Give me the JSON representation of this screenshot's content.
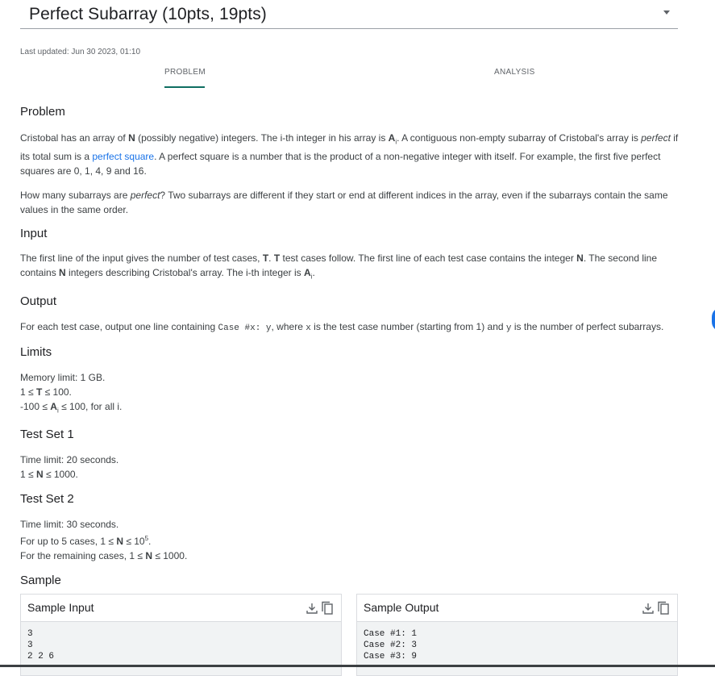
{
  "page": {
    "title": "Perfect Subarray (10pts, 19pts)",
    "last_updated": "Last updated: Jun 30 2023, 01:10",
    "tabs": [
      {
        "label": "PROBLEM",
        "active": true
      },
      {
        "label": "ANALYSIS",
        "active": false
      }
    ]
  },
  "problem": {
    "heading": "Problem",
    "p1": {
      "a": "Cristobal has an array of ",
      "b": "N",
      "c": " (possibly negative) integers. The i-th integer in his array is ",
      "d": "A",
      "e": "i",
      "f": ". A contiguous non-empty subarray of Cristobal's array is ",
      "g": "perfect",
      "h": " if its total sum is a ",
      "link": "perfect square",
      "i": ". A perfect square is a number that is the product of a non-negative integer with itself. For example, the first five perfect squares are 0, 1, 4, 9 and 16."
    },
    "p2": {
      "a": "How many subarrays are ",
      "b": "perfect",
      "c": "? Two subarrays are different if they start or end at different indices in the array, even if the subarrays contain the same values in the same order."
    }
  },
  "input": {
    "heading": "Input",
    "a": "The first line of the input gives the number of test cases, ",
    "T1": "T",
    "b": ". ",
    "T2": "T",
    "c": " test cases follow. The first line of each test case contains the integer ",
    "N1": "N",
    "d": ". The second line contains ",
    "N2": "N",
    "e": " integers describing Cristobal's array. The i-th integer is ",
    "A": "A",
    "Ai": "i",
    "f": "."
  },
  "output": {
    "heading": "Output",
    "a": "For each test case, output one line containing ",
    "code": "Case #x: y",
    "b": ", where ",
    "x": "x",
    "c": " is the test case number (starting from 1) and ",
    "y": "y",
    "d": " is the number of perfect subarrays."
  },
  "limits": {
    "heading": "Limits",
    "memory": "Memory limit: 1 GB.",
    "t_a": "1 ≤ ",
    "t_b": "T",
    "t_c": " ≤ 100.",
    "a_a": "-100 ≤ ",
    "a_b": "A",
    "a_i": "i",
    "a_c": " ≤ 100, for all i."
  },
  "testset1": {
    "heading": "Test Set 1",
    "time": "Time limit: 20 seconds.",
    "n_a": "1 ≤ ",
    "n_b": "N",
    "n_c": " ≤ 1000."
  },
  "testset2": {
    "heading": "Test Set 2",
    "time": "Time limit: 30 seconds.",
    "l1_a": "For up to 5 cases, 1 ≤ ",
    "l1_b": "N",
    "l1_c": " ≤ 10",
    "l1_sup": "5",
    "l1_d": ".",
    "l2_a": "For the remaining cases, 1 ≤ ",
    "l2_b": "N",
    "l2_c": " ≤ 1000."
  },
  "sample": {
    "heading": "Sample",
    "input_title": "Sample Input",
    "input_text": "3\n3\n2 2 6",
    "output_title": "Sample Output",
    "output_text": "Case #1: 1\nCase #2: 3\nCase #3: 9"
  },
  "colors": {
    "accent": "#0f6e62",
    "link": "#1a73e8"
  }
}
